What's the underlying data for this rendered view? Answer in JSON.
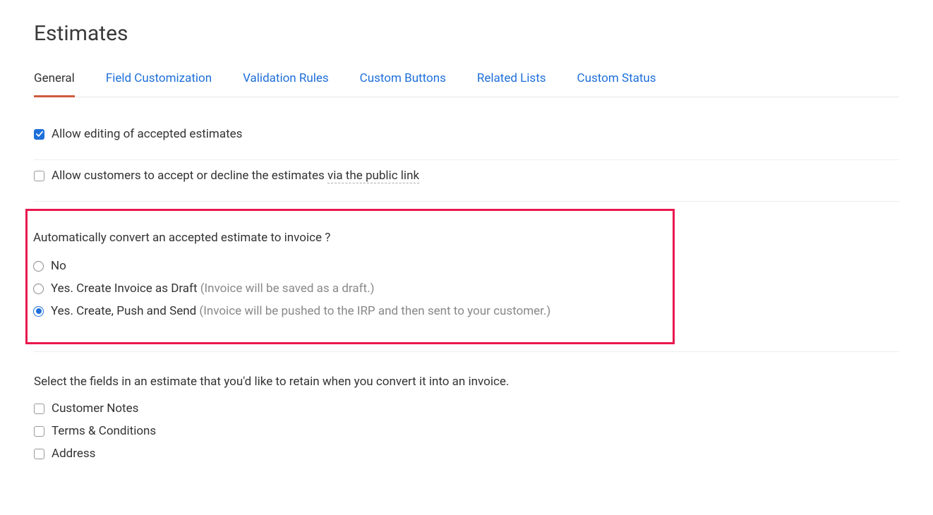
{
  "title": "Estimates",
  "tabs": [
    {
      "label": "General",
      "active": true
    },
    {
      "label": "Field Customization",
      "active": false
    },
    {
      "label": "Validation Rules",
      "active": false
    },
    {
      "label": "Custom Buttons",
      "active": false
    },
    {
      "label": "Related Lists",
      "active": false
    },
    {
      "label": "Custom Status",
      "active": false
    }
  ],
  "options": {
    "allow_edit_accepted": {
      "label": "Allow editing of accepted estimates",
      "checked": true
    },
    "allow_accept_decline_public": {
      "label_prefix": "Allow customers to accept or decline the estimates ",
      "label_dotted": "via the public link",
      "checked": false
    }
  },
  "convert": {
    "question": "Automatically convert an accepted estimate to invoice ?",
    "options": [
      {
        "label": "No",
        "hint": "",
        "selected": false
      },
      {
        "label": "Yes. Create Invoice as Draft ",
        "hint": "(Invoice will be saved as a draft.)",
        "selected": false
      },
      {
        "label": "Yes. Create, Push and Send ",
        "hint": "(Invoice will be pushed to the IRP and then sent to your customer.)",
        "selected": true
      }
    ]
  },
  "retain": {
    "label": "Select the fields in an estimate that you'd like to retain when you convert it into an invoice.",
    "fields": [
      {
        "label": "Customer Notes",
        "checked": false
      },
      {
        "label": "Terms & Conditions",
        "checked": false
      },
      {
        "label": "Address",
        "checked": false
      }
    ]
  }
}
